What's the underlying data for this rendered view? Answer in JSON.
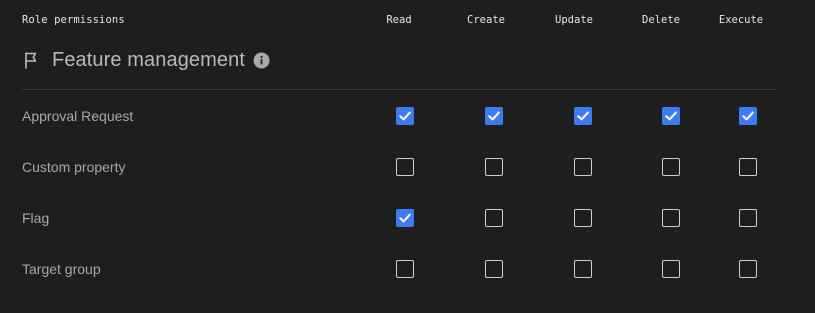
{
  "table": {
    "title": "Role permissions",
    "columns": [
      "Read",
      "Create",
      "Update",
      "Delete",
      "Execute"
    ]
  },
  "section": {
    "title": "Feature management",
    "icon": "flag-icon",
    "info_icon": "info-icon"
  },
  "rows": [
    {
      "label": "Approval Request",
      "permissions": [
        true,
        true,
        true,
        true,
        true
      ]
    },
    {
      "label": "Custom property",
      "permissions": [
        false,
        false,
        false,
        false,
        false
      ]
    },
    {
      "label": "Flag",
      "permissions": [
        true,
        false,
        false,
        false,
        false
      ]
    },
    {
      "label": "Target group",
      "permissions": [
        false,
        false,
        false,
        false,
        false
      ]
    }
  ],
  "colors": {
    "checked": "#3d7bf5",
    "background": "#1e1e1e",
    "divider": "#3a3a3a"
  }
}
